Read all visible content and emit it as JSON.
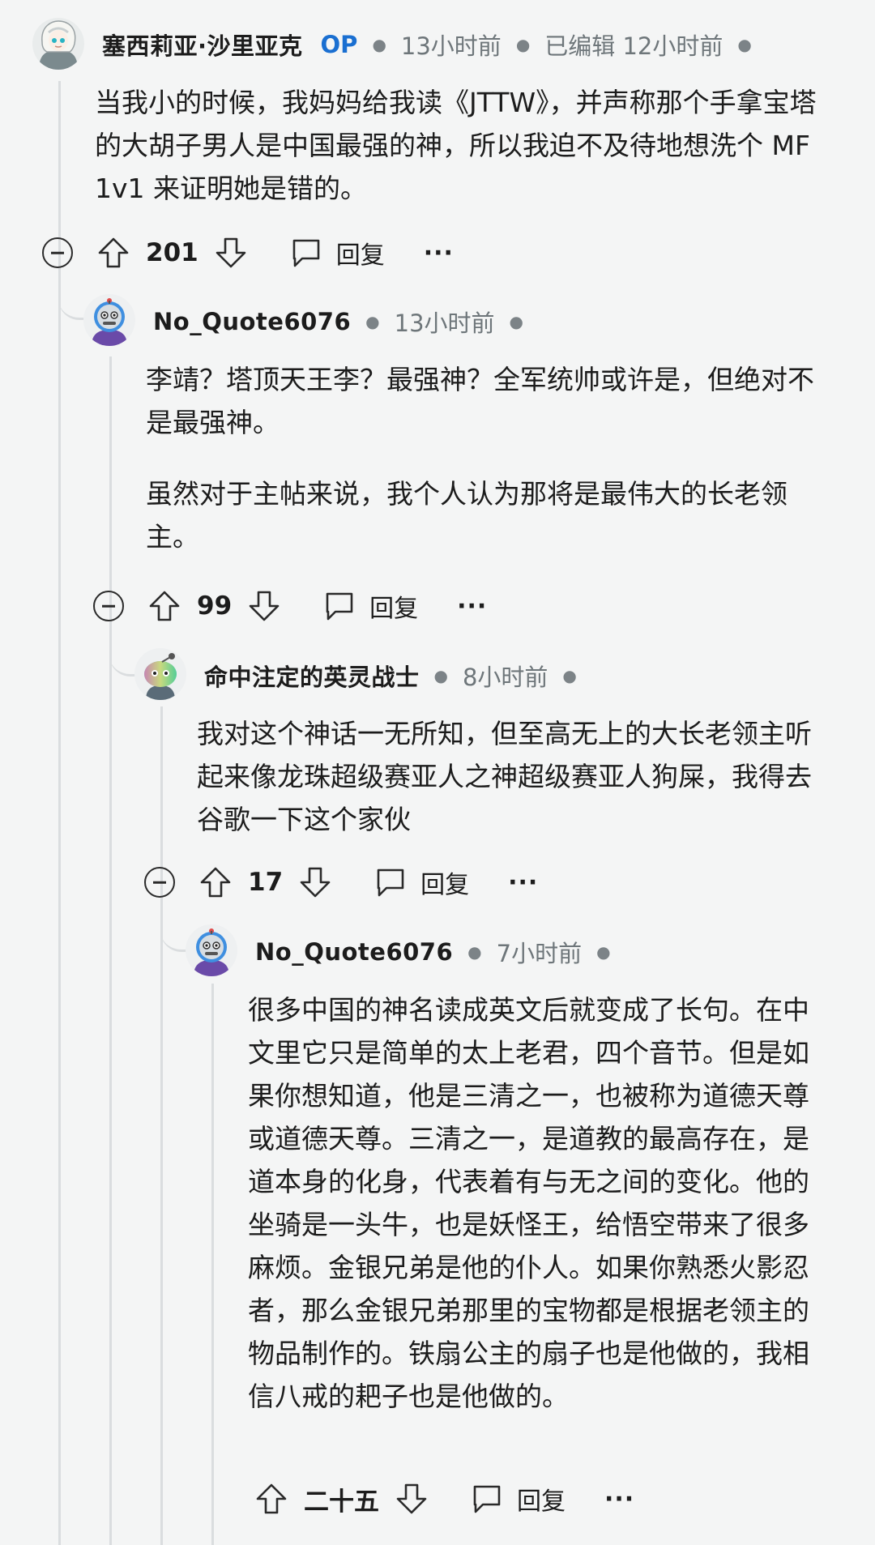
{
  "comments": [
    {
      "author": "塞西莉亚·沙里亚克",
      "op_badge": "OP",
      "time": "13小时前",
      "edited": "已编辑 12小时前",
      "body": [
        "当我小的时候，我妈妈给我读《JTTW》，并声称那个手拿宝塔的大胡子男人是中国最强的神，所以我迫不及待地想洗个 MF 1v1 来证明她是错的。"
      ],
      "score": "201",
      "reply_label": "回复",
      "more": "···",
      "avatar_icon": "girl-avatar-icon"
    },
    {
      "author": "No_Quote6076",
      "time": "13小时前",
      "body": [
        "李靖？塔顶天王李？最强神？全军统帅或许是，但绝对不是最强神。",
        "虽然对于主帖来说，我个人认为那将是最伟大的长老领主。"
      ],
      "score": "99",
      "reply_label": "回复",
      "more": "···",
      "avatar_icon": "robot-avatar-icon"
    },
    {
      "author": "命中注定的英灵战士",
      "time": "8小时前",
      "body": [
        "我对这个神话一无所知，但至高无上的大长老领主听起来像龙珠超级赛亚人之神超级赛亚人狗屎，我得去谷歌一下这个家伙"
      ],
      "score": "17",
      "reply_label": "回复",
      "more": "···",
      "avatar_icon": "snoo-avatar-icon"
    },
    {
      "author": "No_Quote6076",
      "time": "7小时前",
      "body": [
        "很多中国的神名读成英文后就变成了长句。在中文里它只是简单的太上老君，四个音节。但是如果你想知道，他是三清之一，也被称为道德天尊或道德天尊。三清之一，是道教的最高存在，是道本身的化身，代表着有与无之间的变化。他的坐骑是一头牛，也是妖怪王，给悟空带来了很多麻烦。金银兄弟是他的仆人。如果你熟悉火影忍者，那么金银兄弟那里的宝物都是根据老领主的物品制作的。铁扇公主的扇子也是他做的，我相信八戒的耙子也是他做的。"
      ],
      "score": "二十五",
      "reply_label": "回复",
      "more": "···",
      "avatar_icon": "robot-avatar-icon"
    }
  ],
  "colors": {
    "op": "#1a6fd1",
    "background": "#f4f5f5",
    "thread_line": "#dadddf"
  }
}
